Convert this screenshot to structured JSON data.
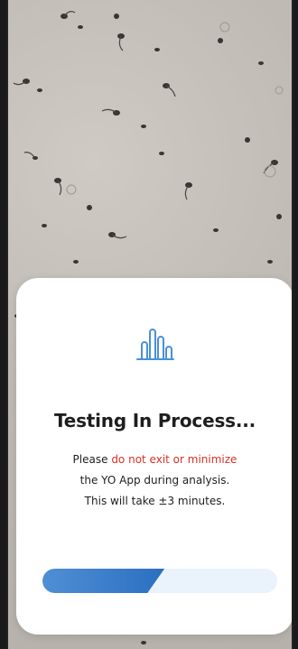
{
  "dialog": {
    "title": "Testing In Process...",
    "message_prefix": "Please ",
    "message_warning": "do not exit or minimize",
    "message_line2": "the YO App during analysis.",
    "message_line3": "This will take ±3 minutes.",
    "icon": "bar-chart-icon"
  },
  "progress": {
    "fraction": 0.52
  },
  "colors": {
    "warning": "#d93025",
    "accent": "#2b6fc1",
    "icon": "#4a90d9",
    "track": "#eaf2fb"
  }
}
